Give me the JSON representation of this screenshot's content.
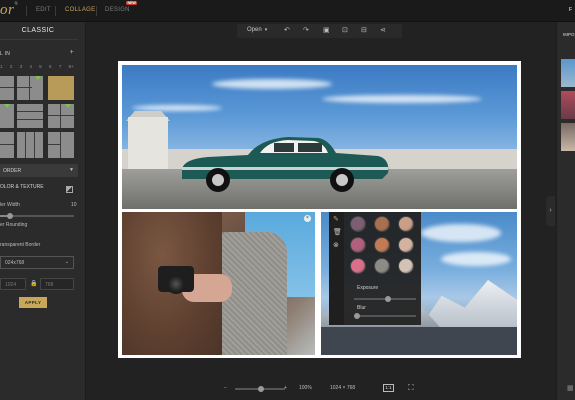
{
  "header": {
    "logo": "or",
    "logo_mark": "®",
    "nav": [
      "EDIT",
      "COLLAGE",
      "DESIGN"
    ],
    "active_nav": "COLLAGE",
    "new_badge": "NEW",
    "right_fragment": "F"
  },
  "sidebar": {
    "title": "CLASSIC",
    "section_fill": "L IN",
    "plus": "+",
    "numbers": [
      "1",
      "2",
      "3",
      "4",
      "5",
      "6",
      "7",
      "8+"
    ],
    "border_label": "ORDER",
    "color_texture": "OLOR & TEXTURE",
    "inner_width_label": "ler Width",
    "inner_width_value": "10",
    "inner_width_fraction": 0.1,
    "rounding_label": "er Rounding",
    "rounding_value": "0",
    "rounding_fraction": 0.0,
    "transparent_label": "ransparent Border",
    "size_preset": "024x768",
    "width_value": "1024",
    "height_value": "768",
    "apply_label": "APPLY"
  },
  "toolbar": {
    "open_label": "Open",
    "icons": [
      "undo-icon",
      "redo-icon",
      "image-icon",
      "crop-icon",
      "export-icon",
      "share-icon"
    ]
  },
  "filter_panel": {
    "tools": [
      "brush-icon",
      "trash-icon",
      "reset-icon"
    ],
    "exposure_label": "Exposure",
    "exposure_fraction": 0.5,
    "blur_label": "Blur",
    "blur_fraction": 0.0,
    "swatch_colors": [
      "#7c5f74",
      "#a8704e",
      "#c99f8a",
      "#b25f7b",
      "#c07a55",
      "#d3b2a0",
      "#d96f8a",
      "#8e8a86",
      "#d3c3b6"
    ]
  },
  "bottom": {
    "zoom_minus": "−",
    "zoom_plus": "+",
    "zoom_level": "100%",
    "zoom_fraction": 0.45,
    "dimensions": "1024 × 768",
    "ratio_label": "1:1"
  },
  "right_panel": {
    "label": "IMPO"
  },
  "colors": {
    "accent": "#c8a75a",
    "panel_bg": "#2b2b2b",
    "app_bg": "#222222"
  }
}
